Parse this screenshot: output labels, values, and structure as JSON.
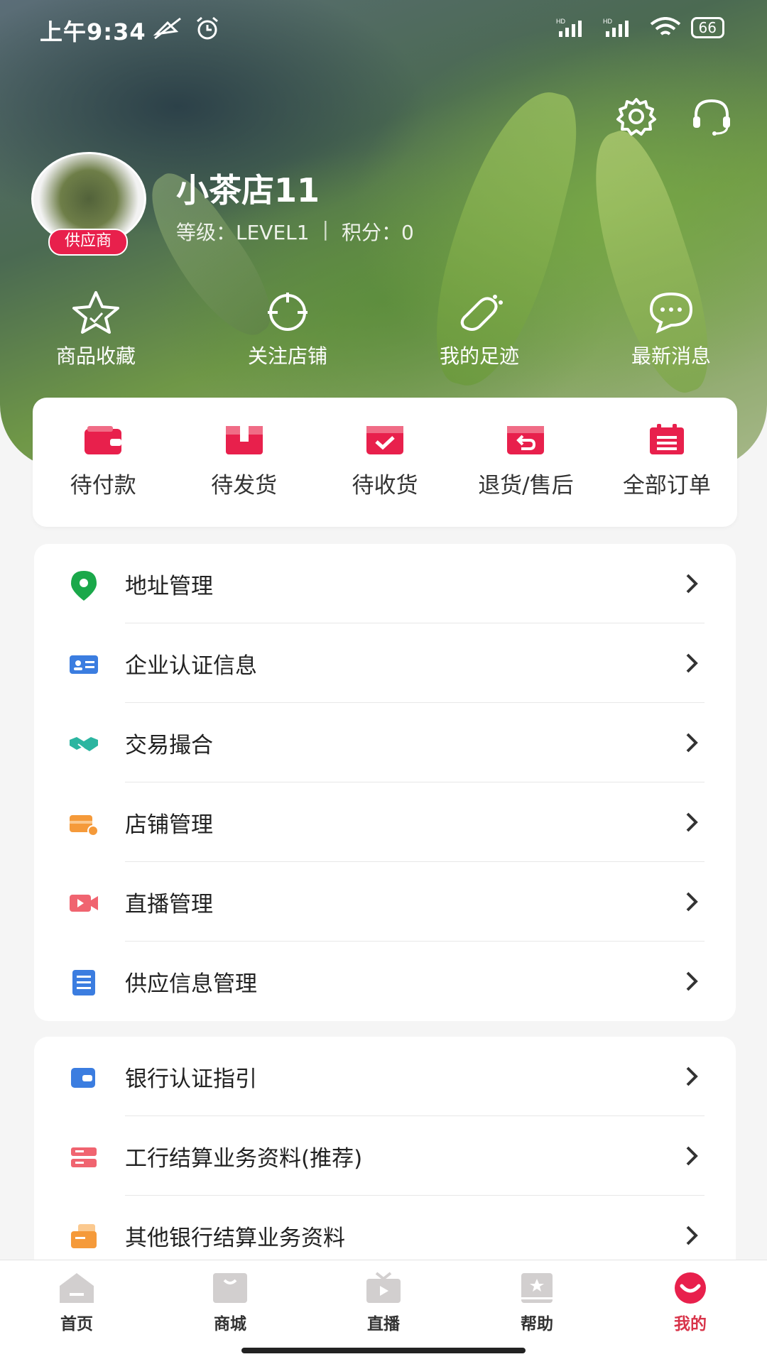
{
  "status_bar": {
    "time": "上午9:34",
    "battery": "66"
  },
  "profile": {
    "shop_name": "小茶店11",
    "badge": "供应商",
    "level_label": "等级：",
    "level_value": "LEVEL1",
    "separator": "|",
    "points_label": "积分：",
    "points_value": "0"
  },
  "header_icons": [
    "gear-icon",
    "headset-icon"
  ],
  "quick_links": [
    {
      "label": "商品收藏",
      "icon": "star-icon"
    },
    {
      "label": "关注店铺",
      "icon": "target-icon"
    },
    {
      "label": "我的足迹",
      "icon": "footprint-icon"
    },
    {
      "label": "最新消息",
      "icon": "message-icon"
    }
  ],
  "orders": [
    {
      "label": "待付款",
      "icon": "wallet-icon"
    },
    {
      "label": "待发货",
      "icon": "box-icon"
    },
    {
      "label": "待收货",
      "icon": "inbox-check-icon"
    },
    {
      "label": "退货/售后",
      "icon": "return-icon"
    },
    {
      "label": "全部订单",
      "icon": "clipboard-icon"
    }
  ],
  "menu_group1": [
    {
      "label": "地址管理",
      "icon": "location-pin-icon",
      "color": "#1aa84a"
    },
    {
      "label": "企业认证信息",
      "icon": "id-card-icon",
      "color": "#3b7de0"
    },
    {
      "label": "交易撮合",
      "icon": "handshake-icon",
      "color": "#2bb5a0"
    },
    {
      "label": "店铺管理",
      "icon": "shop-settings-icon",
      "color": "#f59a3a"
    },
    {
      "label": "直播管理",
      "icon": "video-icon",
      "color": "#f06470"
    },
    {
      "label": "供应信息管理",
      "icon": "document-icon",
      "color": "#3b7de0"
    }
  ],
  "menu_group2": [
    {
      "label": "银行认证指引",
      "icon": "bank-card-icon",
      "color": "#3b7de0"
    },
    {
      "label": "工行结算业务资料(推荐)",
      "icon": "server-icon",
      "color": "#f06470"
    },
    {
      "label": "其他银行结算业务资料",
      "icon": "files-icon",
      "color": "#f59a3a"
    }
  ],
  "tabs": [
    {
      "label": "首页",
      "icon": "home-icon"
    },
    {
      "label": "商城",
      "icon": "bag-icon"
    },
    {
      "label": "直播",
      "icon": "tv-icon"
    },
    {
      "label": "帮助",
      "icon": "help-book-icon"
    },
    {
      "label": "我的",
      "icon": "smile-icon",
      "active": true
    }
  ],
  "colors": {
    "accent": "#e8204c",
    "active_tab": "#d8344a"
  }
}
